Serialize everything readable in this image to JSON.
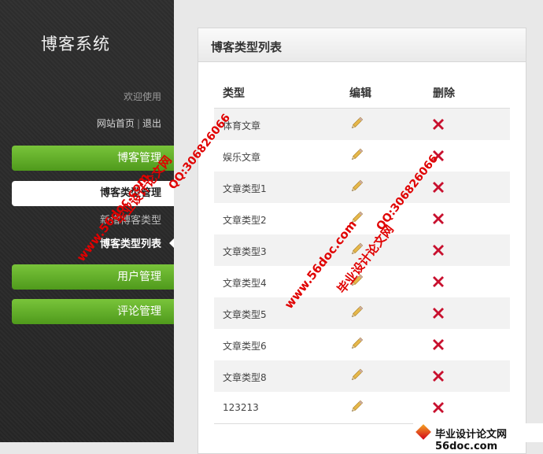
{
  "sidebar": {
    "app_title": "博客系统",
    "welcome": "欢迎使用",
    "links": {
      "home": "网站首页",
      "separator": "|",
      "logout": "退出"
    },
    "nav": {
      "blog_manage": "博客管理",
      "blog_type_manage": "博客类型管理",
      "add_blog_type": "新增博客类型",
      "blog_type_list": "博客类型列表",
      "user_manage": "用户管理",
      "comment_manage": "评论管理"
    }
  },
  "panel": {
    "title": "博客类型列表",
    "columns": {
      "type": "类型",
      "edit": "编辑",
      "delete": "删除"
    },
    "rows": [
      {
        "name": "体育文章"
      },
      {
        "name": "娱乐文章"
      },
      {
        "name": "文章类型1"
      },
      {
        "name": "文章类型2"
      },
      {
        "name": "文章类型3"
      },
      {
        "name": "文章类型4"
      },
      {
        "name": "文章类型5"
      },
      {
        "name": "文章类型6"
      },
      {
        "name": "文章类型8"
      },
      {
        "name": "123213"
      }
    ],
    "icons": {
      "edit": "pencil-icon",
      "delete": "red-x-icon"
    }
  },
  "watermarks": {
    "site": "www.56doc.com",
    "qq": "QQ:306826066",
    "brand": "毕业设计论文网",
    "corner": "毕业设计论文网 56doc.com"
  },
  "colors": {
    "sidebar_bg": "#2a2a2a",
    "nav_green": "#5fab25",
    "delete_red": "#c8102e",
    "watermark_red": "#e00000"
  }
}
